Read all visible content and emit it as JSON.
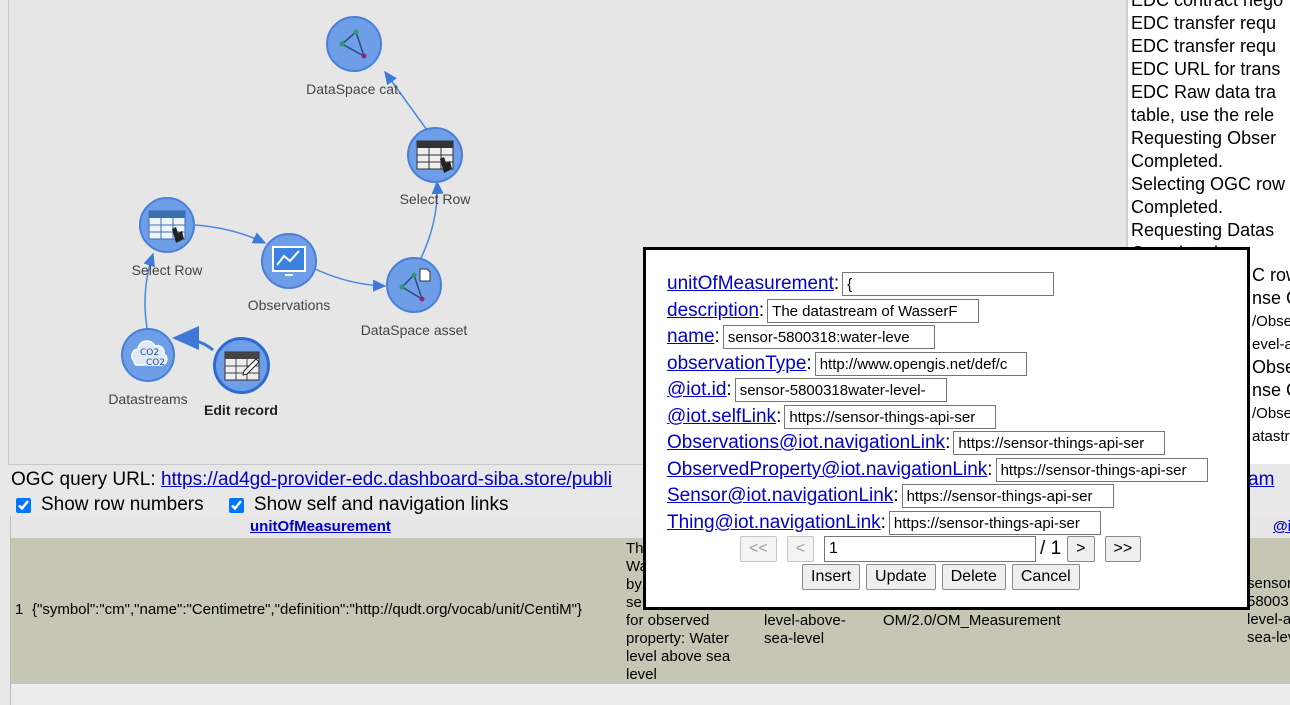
{
  "nodes": {
    "dataspace_cat": {
      "label": "DataSpace cat."
    },
    "select_row_top": {
      "label": "Select Row"
    },
    "select_row_left": {
      "label": "Select Row"
    },
    "observations": {
      "label": "Observations"
    },
    "dataspace_asset": {
      "label": "DataSpace asset"
    },
    "datastreams": {
      "label": "Datastreams"
    },
    "edit_record": {
      "label": "Edit record"
    }
  },
  "log": {
    "lines": [
      "EDC contract nego",
      "EDC transfer requ",
      "EDC transfer requ",
      "EDC URL for trans",
      "EDC Raw data tra",
      "table, use the rele",
      "Requesting Obser",
      "Completed.",
      "Selecting OGC row",
      "Completed.",
      "Requesting Datas",
      "Completed."
    ],
    "partial_right": [
      "C row",
      "nse C",
      "/Obse",
      "evel-a",
      "Obser",
      "nse C",
      "/Obse",
      "atastr"
    ]
  },
  "query": {
    "label": "OGC query URL: ",
    "url": "https://ad4gd-provider-edc.dashboard-siba.store/publi",
    "url_tail": "am"
  },
  "options": {
    "show_row_numbers": "Show row numbers",
    "show_links": "Show self and navigation links"
  },
  "grid": {
    "headers": {
      "unitOfMeasurement": "unitOfMeasurement",
      "iot_partial": "@i"
    },
    "row": {
      "number": "1",
      "unit": "{\"symbol\":\"cm\",\"name\":\"Centimetre\",\"definition\":\"http://qudt.org/vocab/unit/CentiM\"}",
      "description_top": [
        "Th",
        "Wa",
        "by",
        "se"
      ],
      "description_bottom": [
        "for observed",
        "property: Water",
        "level above sea",
        "level"
      ],
      "name_tail": [
        "level-above-",
        "sea-level"
      ],
      "type_tail": "OM/2.0/OM_Measurement",
      "iot_id": [
        "sensor",
        "58003",
        "level-a",
        "sea-lev"
      ]
    }
  },
  "dialog": {
    "fields": [
      {
        "label": "unitOfMeasurement",
        "value": "{"
      },
      {
        "label": "description",
        "value": "The datastream of WasserF"
      },
      {
        "label": "name",
        "value": "sensor-5800318:water-leve"
      },
      {
        "label": "observationType",
        "value": "http://www.opengis.net/def/c"
      },
      {
        "label": "@iot.id",
        "value": "sensor-5800318water-level-"
      },
      {
        "label": "@iot.selfLink",
        "value": "https://sensor-things-api-ser"
      },
      {
        "label": "Observations@iot.navigationLink",
        "value": "https://sensor-things-api-ser"
      },
      {
        "label": "ObservedProperty@iot.navigationLink",
        "value": "https://sensor-things-api-ser"
      },
      {
        "label": "Sensor@iot.navigationLink",
        "value": "https://sensor-things-api-ser"
      },
      {
        "label": "Thing@iot.navigationLink",
        "value": "https://sensor-things-api-ser"
      }
    ],
    "pager": {
      "first": "<<",
      "prev": "<",
      "current": "1",
      "total": "/ 1",
      "next": ">",
      "last": ">>"
    },
    "buttons": {
      "insert": "Insert",
      "update": "Update",
      "delete": "Delete",
      "cancel": "Cancel"
    }
  }
}
